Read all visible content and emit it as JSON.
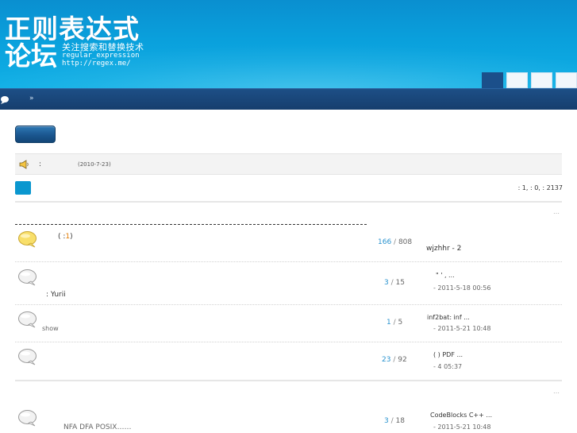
{
  "header": {
    "logo_line1": "正则表达式",
    "logo_line2": "论坛",
    "logo_tagline": "关注搜索和替换技术",
    "logo_english": "regular_expression",
    "logo_url": "http://regex.me/",
    "tab_count": 4
  },
  "nav": {
    "search_icon": "search-icon",
    "separator": "»"
  },
  "announcement": {
    "icon": "megaphone-icon",
    "colon": ":",
    "date": "(2010-7-23)"
  },
  "forum": {
    "stats": ": 1,   : 0,   : 2137",
    "more_1": "…",
    "more_2": "…"
  },
  "threads": [
    {
      "icon": "hot-thread-bubble-icon",
      "title_prefix": "( :",
      "title_num": "1",
      "title_suffix": ")",
      "replies": "166",
      "views": "808",
      "last_author": "wjzhhr - 2",
      "last_time": ""
    },
    {
      "icon": "thread-bubble-icon",
      "title": "",
      "author": ": Yurii",
      "replies": "3",
      "views": "15",
      "last_title": "\" '        , ...",
      "last_time": "- 2011-5-18 00:56"
    },
    {
      "icon": "thread-bubble-icon",
      "title": "",
      "author": "show",
      "replies": "1",
      "views": "5",
      "last_title": "inf2bat: inf          ...",
      "last_time": "- 2011-5-21 10:48"
    },
    {
      "icon": "thread-bubble-icon",
      "title": "",
      "author": "",
      "replies": "23",
      "views": "92",
      "last_title": "(   )    PDF ...",
      "last_time": "- 4    05:37"
    },
    {
      "icon": "thread-bubble-icon",
      "title": "NFA DFA POSIX……",
      "author": "",
      "replies": "3",
      "views": "18",
      "last_title": "CodeBlocks  C++      ...",
      "last_time": "- 2011-5-21 10:48"
    }
  ],
  "colors": {
    "header_blue": "#0aa0dc",
    "navbar_blue": "#1a4677",
    "reply_blue": "#2a93cf",
    "accent_orange": "#e07a00"
  }
}
